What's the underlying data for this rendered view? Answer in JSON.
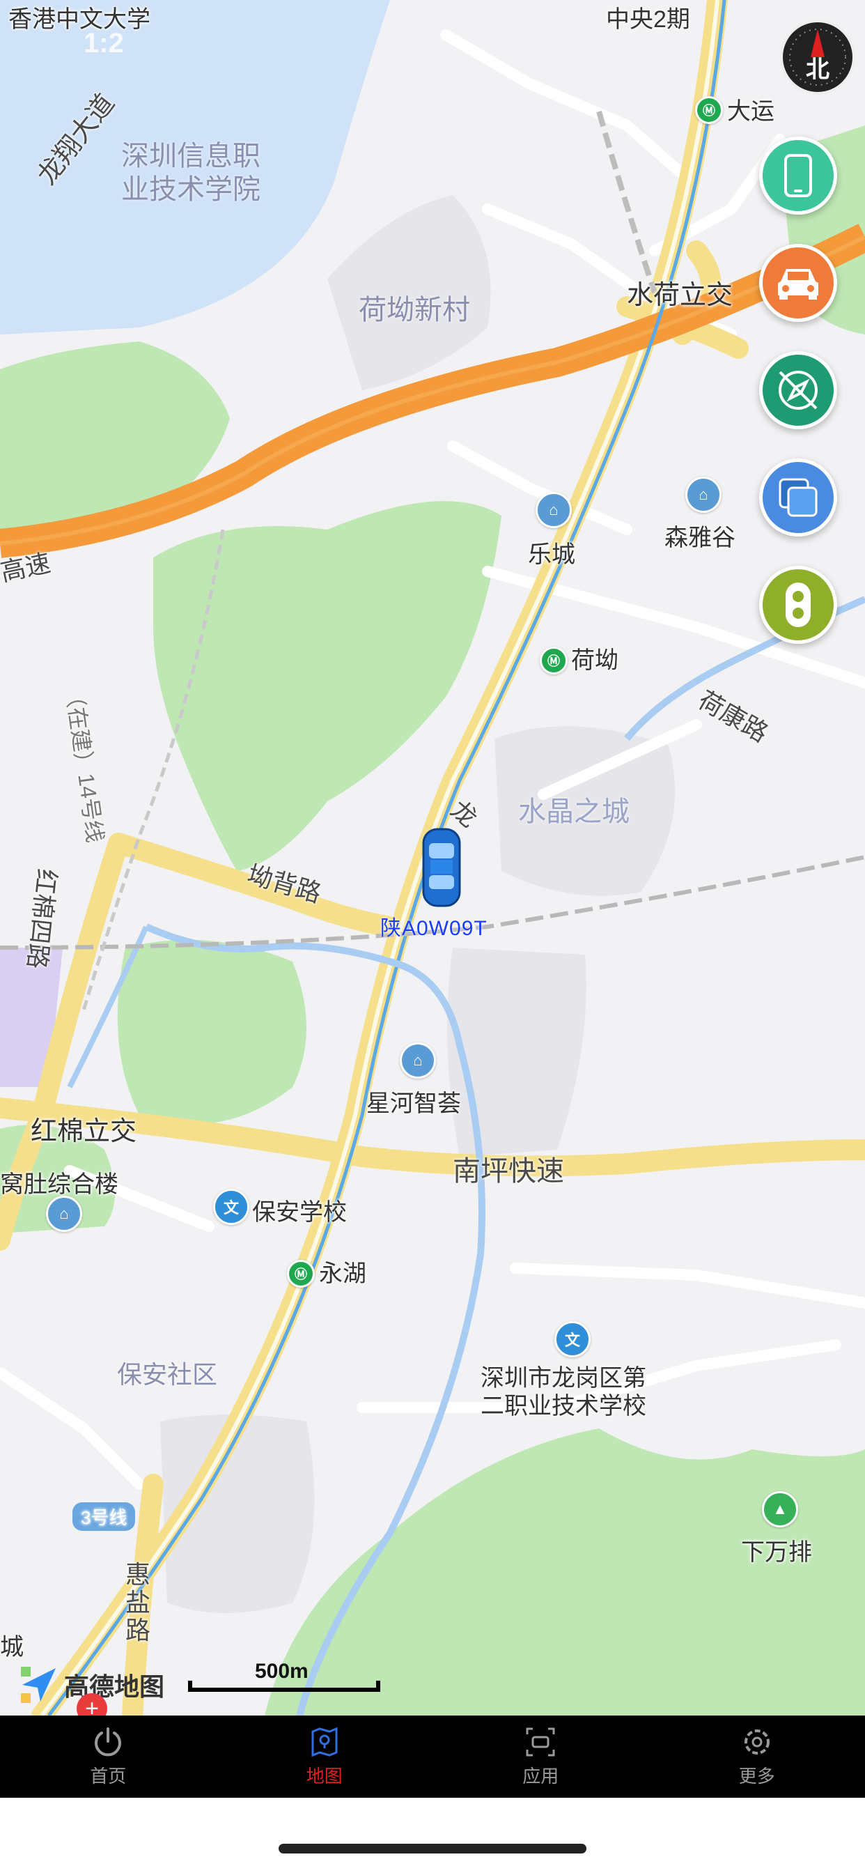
{
  "status_bar": {
    "time": "1:2"
  },
  "map": {
    "labels": {
      "university": "香港中文大学",
      "central_phase2": "中央2期",
      "road_longxiang": "龙翔大道",
      "institute": "深圳信息职\n业技术学院",
      "hao_village": "荷坳新村",
      "highway": "高速",
      "interchange_shuihe": "水荷立交",
      "dayun": "大运",
      "lecheng": "乐城",
      "senyagu": "森雅谷",
      "station_heao": "荷坳",
      "road_hekang": "荷康路",
      "crystal_city": "水晶之城",
      "line14": "（在建）14号线",
      "road_aobei": "坳背路",
      "road_long": "龙",
      "road_hongmian4": "红棉四路",
      "xinghe": "星河智荟",
      "interchange_hongmian": "红棉立交",
      "nanping": "南坪快速",
      "wodu": "窝肚综合楼",
      "baoan_school": "保安学校",
      "station_yonghu": "永湖",
      "baoan_community": "保安社区",
      "vocational": "深圳市龙岗区第\n二职业技术学校",
      "line3": "3号线",
      "road_huiyan": "惠\n盐\n路",
      "xiawanpai": "下万排",
      "cheng": "城"
    },
    "vehicle_plate": "陕A0W09T",
    "scale_label": "500m",
    "logo_text": "高德地图",
    "compass_label": "北"
  },
  "side_buttons": [
    {
      "name": "phone",
      "color": "#3cc49a"
    },
    {
      "name": "car",
      "color": "#f07a3a"
    },
    {
      "name": "compass-nav",
      "color": "#1e9b72"
    },
    {
      "name": "layers",
      "color": "#4a8be0"
    },
    {
      "name": "traffic-light",
      "color": "#8fae2a"
    }
  ],
  "tabbar": {
    "tabs": [
      {
        "label": "首页",
        "icon": "power-icon"
      },
      {
        "label": "地图",
        "icon": "map-icon",
        "active": true
      },
      {
        "label": "应用",
        "icon": "apps-icon"
      },
      {
        "label": "更多",
        "icon": "settings-icon"
      }
    ]
  }
}
